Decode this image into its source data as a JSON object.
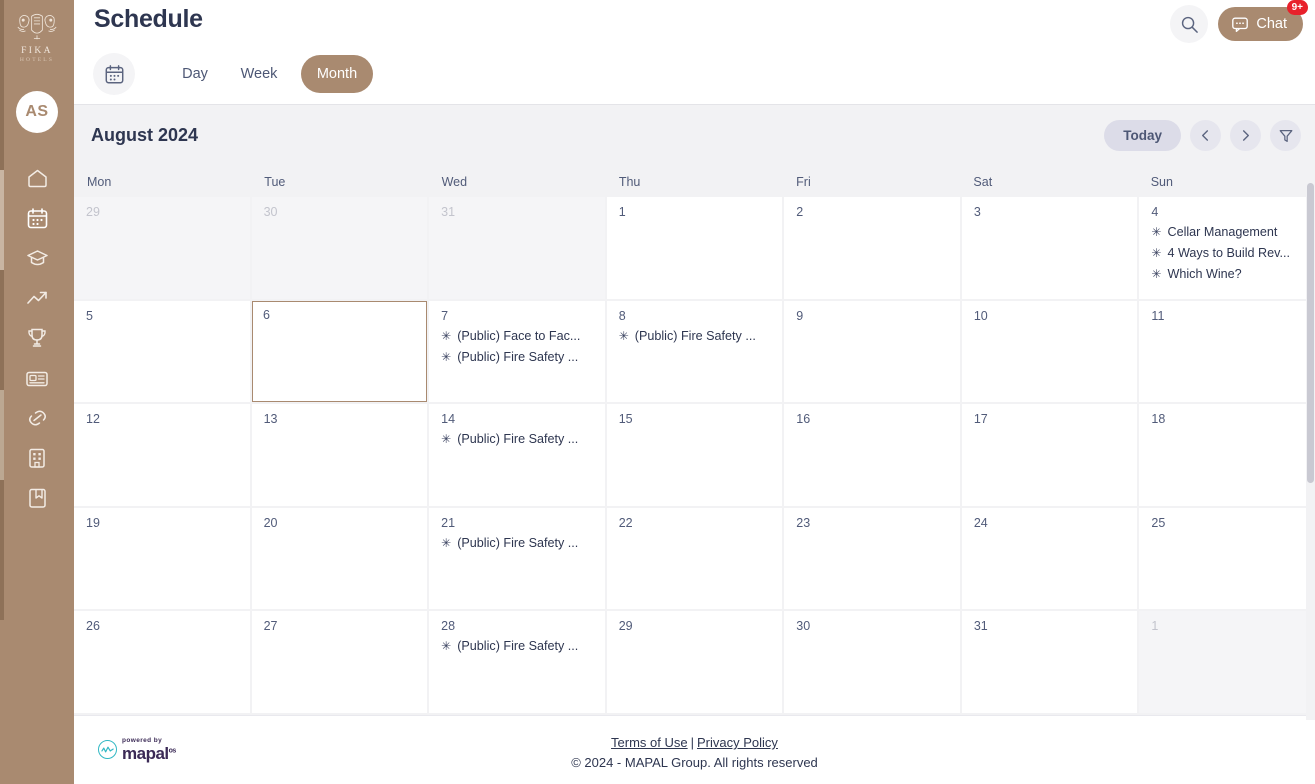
{
  "sidebar": {
    "brand": {
      "name": "FIKA",
      "sub": "HOTELS"
    },
    "avatar": "AS",
    "items": [
      {
        "label": "Home",
        "icon": "home-icon"
      },
      {
        "label": "Schedule",
        "icon": "calendar-icon"
      },
      {
        "label": "Learning",
        "icon": "graduation-cap-icon"
      },
      {
        "label": "Performance",
        "icon": "trending-up-icon"
      },
      {
        "label": "Achievements",
        "icon": "trophy-icon"
      },
      {
        "label": "News",
        "icon": "news-card-icon"
      },
      {
        "label": "Links",
        "icon": "chain-link-icon"
      },
      {
        "label": "Organisation",
        "icon": "building-icon"
      },
      {
        "label": "Library",
        "icon": "book-icon"
      }
    ]
  },
  "header": {
    "title": "Schedule",
    "search_icon": "search-icon",
    "chat_label": "Chat",
    "chat_badge": "9+",
    "chat_icon": "chat-bubble-icon",
    "calendar_toggle_icon": "calendar-icon"
  },
  "views": {
    "day": "Day",
    "week": "Week",
    "month": "Month",
    "active": "Month"
  },
  "calendar": {
    "month_label": "August 2024",
    "today_label": "Today",
    "prev_icon": "chevron-left-icon",
    "next_icon": "chevron-right-icon",
    "filter_icon": "funnel-filter-icon",
    "day_names": [
      "Mon",
      "Tue",
      "Wed",
      "Thu",
      "Fri",
      "Sat",
      "Sun"
    ],
    "weeks": [
      [
        {
          "num": "29",
          "out": true,
          "today": false,
          "events": []
        },
        {
          "num": "30",
          "out": true,
          "today": false,
          "events": []
        },
        {
          "num": "31",
          "out": true,
          "today": false,
          "events": []
        },
        {
          "num": "1",
          "out": false,
          "today": false,
          "events": []
        },
        {
          "num": "2",
          "out": false,
          "today": false,
          "events": []
        },
        {
          "num": "3",
          "out": false,
          "today": false,
          "events": []
        },
        {
          "num": "4",
          "out": false,
          "today": false,
          "events": [
            "Cellar Management",
            "4 Ways to Build Rev...",
            "Which Wine?"
          ]
        }
      ],
      [
        {
          "num": "5",
          "out": false,
          "today": false,
          "events": []
        },
        {
          "num": "6",
          "out": false,
          "today": true,
          "events": []
        },
        {
          "num": "7",
          "out": false,
          "today": false,
          "events": [
            "(Public) Face to Fac...",
            "(Public) Fire Safety ..."
          ]
        },
        {
          "num": "8",
          "out": false,
          "today": false,
          "events": [
            "(Public) Fire Safety ..."
          ]
        },
        {
          "num": "9",
          "out": false,
          "today": false,
          "events": []
        },
        {
          "num": "10",
          "out": false,
          "today": false,
          "events": []
        },
        {
          "num": "11",
          "out": false,
          "today": false,
          "events": []
        }
      ],
      [
        {
          "num": "12",
          "out": false,
          "today": false,
          "events": []
        },
        {
          "num": "13",
          "out": false,
          "today": false,
          "events": []
        },
        {
          "num": "14",
          "out": false,
          "today": false,
          "events": [
            "(Public) Fire Safety ..."
          ]
        },
        {
          "num": "15",
          "out": false,
          "today": false,
          "events": []
        },
        {
          "num": "16",
          "out": false,
          "today": false,
          "events": []
        },
        {
          "num": "17",
          "out": false,
          "today": false,
          "events": []
        },
        {
          "num": "18",
          "out": false,
          "today": false,
          "events": []
        }
      ],
      [
        {
          "num": "19",
          "out": false,
          "today": false,
          "events": []
        },
        {
          "num": "20",
          "out": false,
          "today": false,
          "events": []
        },
        {
          "num": "21",
          "out": false,
          "today": false,
          "events": [
            "(Public) Fire Safety ..."
          ]
        },
        {
          "num": "22",
          "out": false,
          "today": false,
          "events": []
        },
        {
          "num": "23",
          "out": false,
          "today": false,
          "events": []
        },
        {
          "num": "24",
          "out": false,
          "today": false,
          "events": []
        },
        {
          "num": "25",
          "out": false,
          "today": false,
          "events": []
        }
      ],
      [
        {
          "num": "26",
          "out": false,
          "today": false,
          "events": []
        },
        {
          "num": "27",
          "out": false,
          "today": false,
          "events": []
        },
        {
          "num": "28",
          "out": false,
          "today": false,
          "events": [
            "(Public) Fire Safety ..."
          ]
        },
        {
          "num": "29",
          "out": false,
          "today": false,
          "events": []
        },
        {
          "num": "30",
          "out": false,
          "today": false,
          "events": []
        },
        {
          "num": "31",
          "out": false,
          "today": false,
          "events": []
        },
        {
          "num": "1",
          "out": true,
          "today": false,
          "events": []
        }
      ]
    ]
  },
  "footer": {
    "logo_powered_by": "powered by",
    "logo_word": "mapal",
    "logo_os": "os",
    "terms": "Terms of Use",
    "separator": "|",
    "privacy": "Privacy Policy",
    "copyright": "© 2024 - MAPAL Group. All rights reserved"
  },
  "colors": {
    "brand": "#a98a70",
    "badge": "#e8212b",
    "text": "#2e3650",
    "today_pill": "#dcdce8"
  }
}
